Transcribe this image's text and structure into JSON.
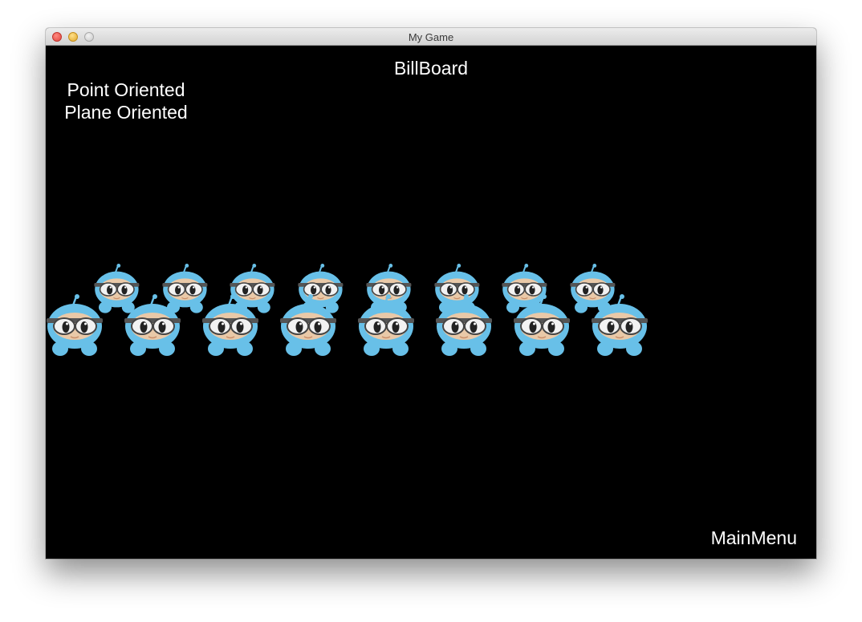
{
  "window": {
    "title": "My Game"
  },
  "scene": {
    "title": "BillBoard",
    "menu": [
      {
        "label": "Point Oriented"
      },
      {
        "label": "Plane Oriented"
      }
    ],
    "main_menu_label": "MainMenu"
  },
  "colors": {
    "background": "#000000",
    "text": "#ffffff",
    "sprite_body": "#68c0e8",
    "sprite_face": "#e9c9a8",
    "traffic_close": "#e0443e",
    "traffic_min": "#e0a82b",
    "traffic_max": "#c9c9c9"
  },
  "sprites": {
    "icon": "blue-ninja-sprite",
    "back_row_count": 8,
    "front_row_count": 8
  }
}
